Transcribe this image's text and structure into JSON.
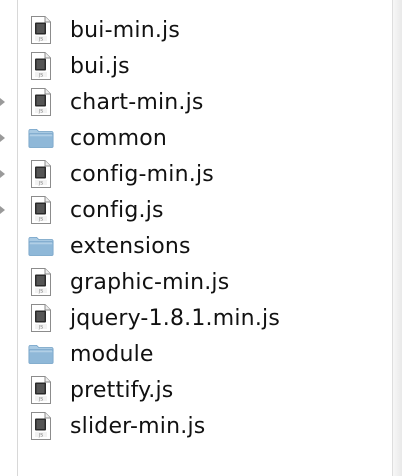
{
  "files": [
    {
      "name": "bui-min.js",
      "kind": "js",
      "icon": "js-file-icon"
    },
    {
      "name": "bui.js",
      "kind": "js",
      "icon": "js-file-icon"
    },
    {
      "name": "chart-min.js",
      "kind": "js",
      "icon": "js-file-icon"
    },
    {
      "name": "common",
      "kind": "folder",
      "icon": "folder-icon"
    },
    {
      "name": "config-min.js",
      "kind": "js",
      "icon": "js-file-icon"
    },
    {
      "name": "config.js",
      "kind": "js",
      "icon": "js-file-icon"
    },
    {
      "name": "extensions",
      "kind": "folder",
      "icon": "folder-icon"
    },
    {
      "name": "graphic-min.js",
      "kind": "js",
      "icon": "js-file-icon"
    },
    {
      "name": "jquery-1.8.1.min.js",
      "kind": "js",
      "icon": "js-file-icon"
    },
    {
      "name": "module",
      "kind": "folder",
      "icon": "folder-icon"
    },
    {
      "name": "prettify.js",
      "kind": "js",
      "icon": "js-file-icon"
    },
    {
      "name": "slider-min.js",
      "kind": "js",
      "icon": "js-file-icon"
    }
  ],
  "gutter": {
    "arrow_rows": [
      2,
      3,
      4,
      5
    ]
  },
  "colors": {
    "folder_body": "#8fb8d8",
    "folder_tab": "#a9cae3",
    "file_sheet": "#ffffff",
    "file_badge": "#2a2a2a"
  }
}
